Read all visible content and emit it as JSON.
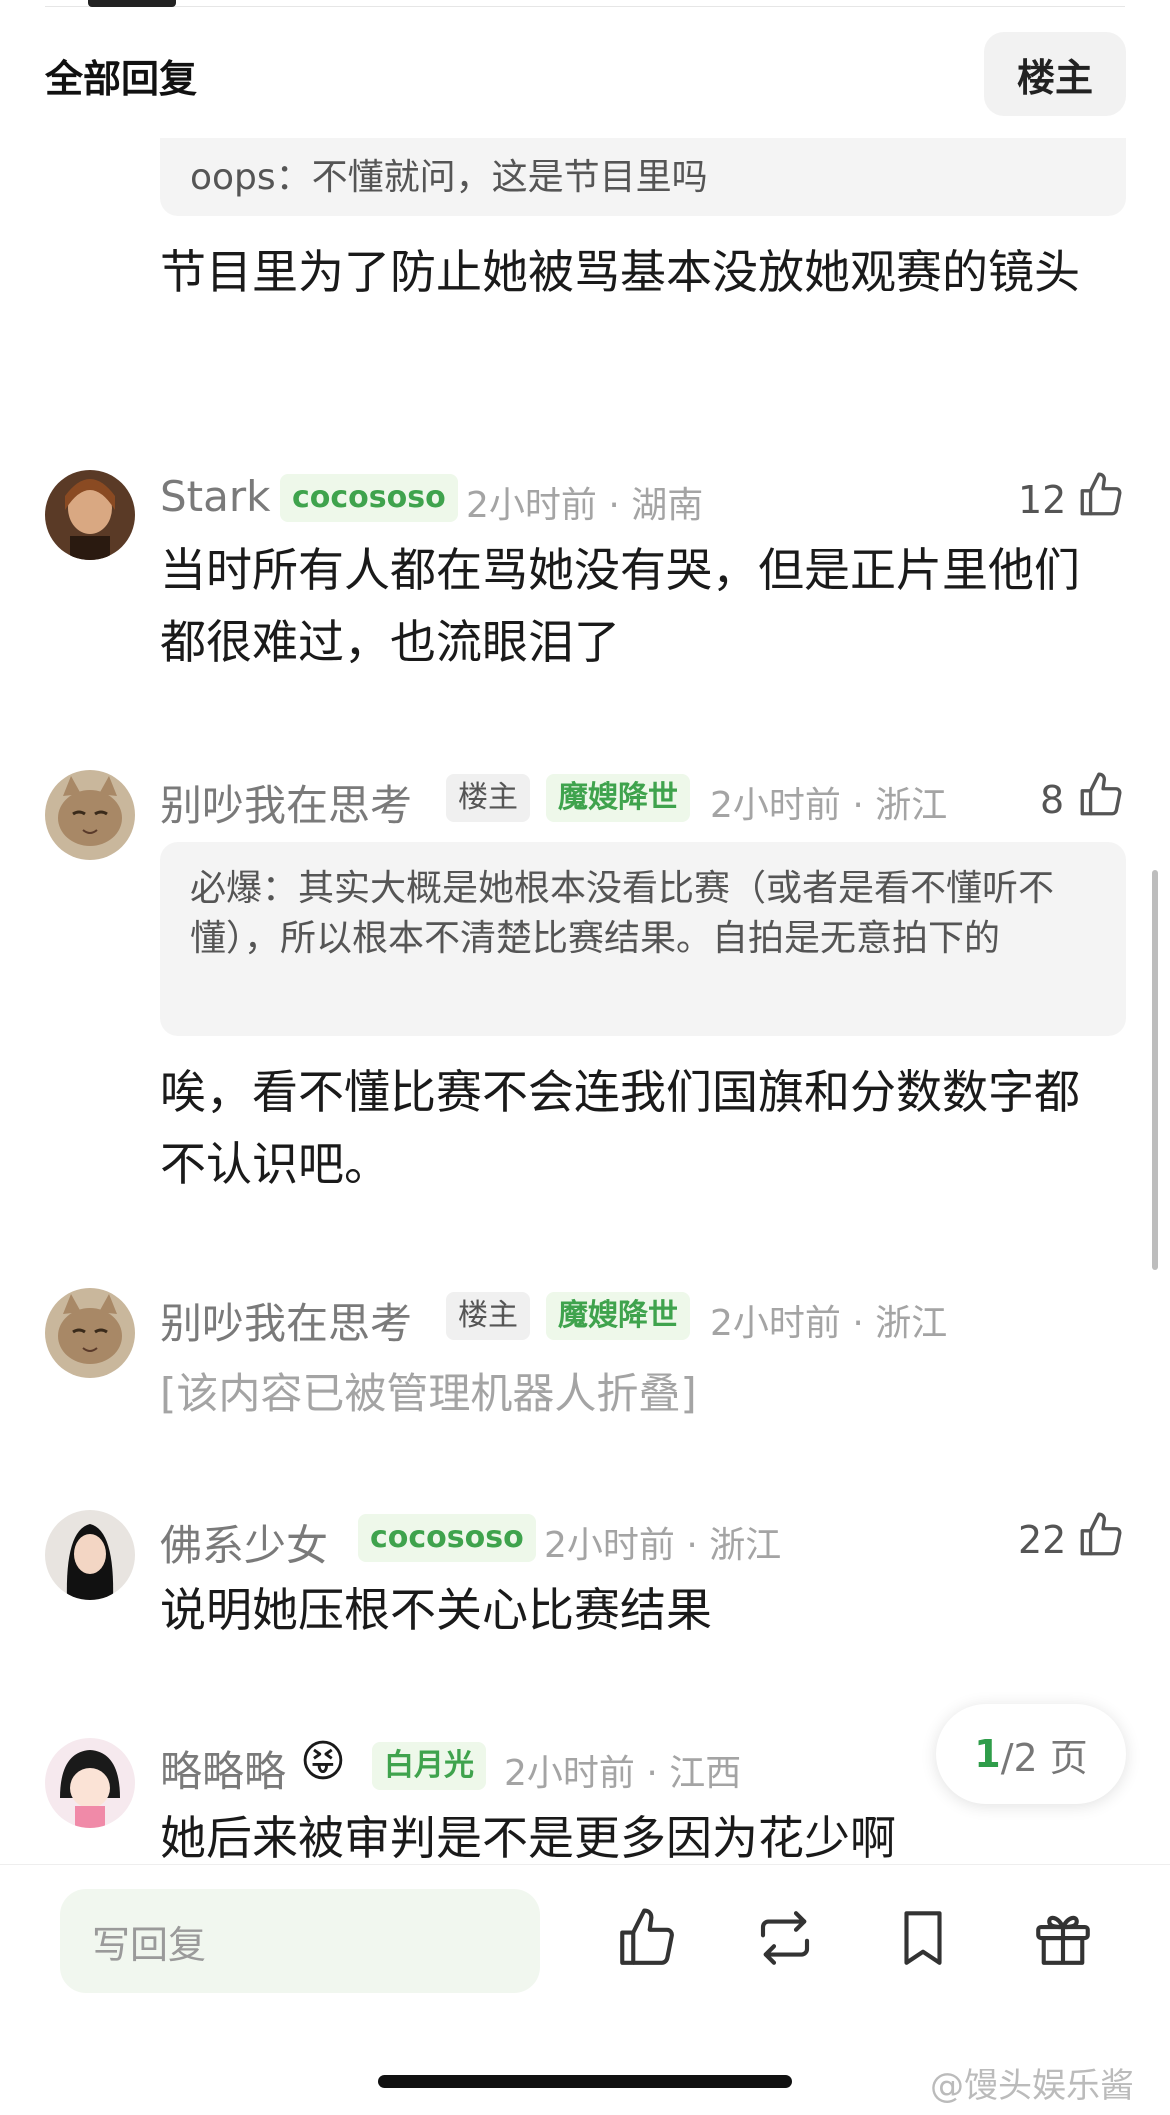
{
  "header": {
    "title": "全部回复",
    "owner_filter": "楼主"
  },
  "quoted_top": "oops：不懂就问，这是节目里吗",
  "first_reply_text": "节目里为了防止她被骂基本没放她观赛的镜头",
  "comments": [
    {
      "name": "Stark",
      "badge": "cocososo",
      "meta": "2小时前 · 湖南",
      "likes": "12",
      "text": "当时所有人都在骂她没有哭，但是正片里他们都很难过，也流眼泪了"
    },
    {
      "name": "别吵我在思考",
      "tag": "楼主",
      "badge": "魔嫂降世",
      "meta": "2小时前 · 浙江",
      "likes": "8",
      "quote": "必爆：其实大概是她根本没看比赛（或者是看不懂听不懂），所以根本不清楚比赛结果。自拍是无意拍下的",
      "text": "唉，看不懂比赛不会连我们国旗和分数数字都不认识吧。"
    },
    {
      "name": "别吵我在思考",
      "tag": "楼主",
      "badge": "魔嫂降世",
      "meta": "2小时前 · 浙江",
      "text": "[该内容已被管理机器人折叠]"
    },
    {
      "name": "佛系少女",
      "badge": "cocososo",
      "meta": "2小时前 · 浙江",
      "likes": "22",
      "text": "说明她压根不关心比赛结果"
    },
    {
      "name": "略略略",
      "emoji": "😝",
      "badge": "白月光",
      "meta": "2小时前 · 江西",
      "text": "她后来被审判是不是更多因为花少啊"
    }
  ],
  "pagination": {
    "current": "1",
    "total": "/2 页"
  },
  "bottom_bar": {
    "reply_placeholder": "写回复"
  },
  "watermark": "@馒头娱乐酱",
  "colors": {
    "accent_green": "#3fa34d",
    "badge_bg": "#eef8ea"
  },
  "icons": [
    "thumbs-up-icon",
    "repost-icon",
    "bookmark-icon",
    "gift-icon"
  ]
}
